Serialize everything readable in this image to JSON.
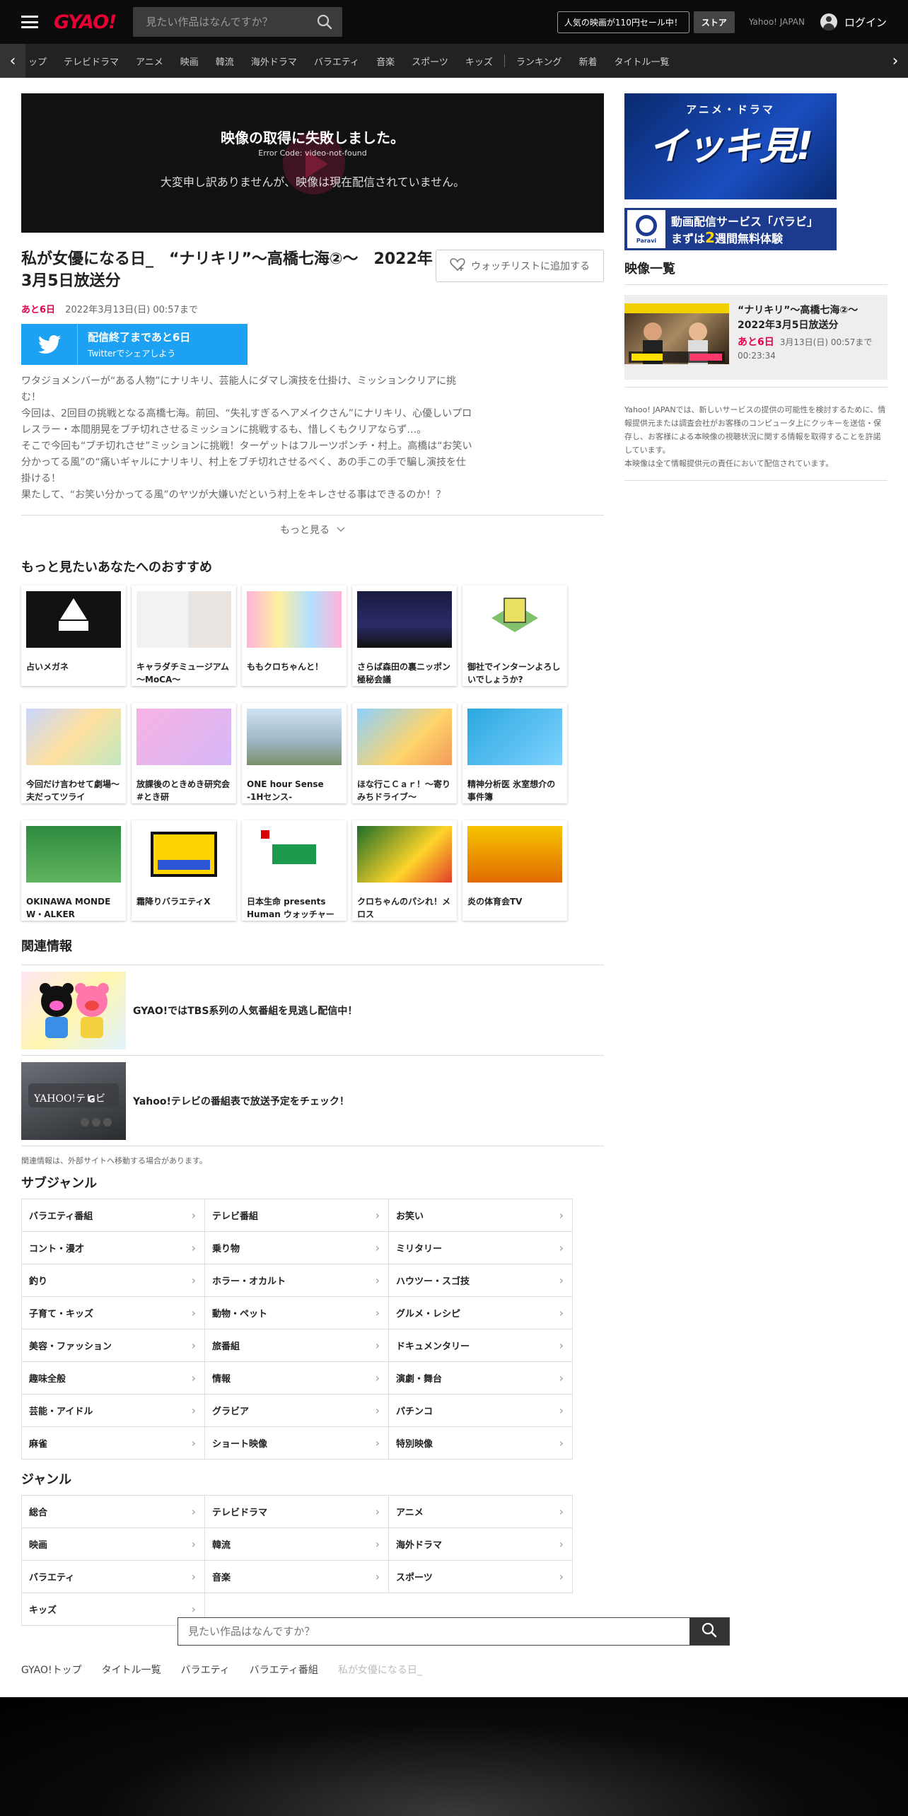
{
  "header": {
    "logo": "GYAO!",
    "search_placeholder": "見たい作品はなんですか？",
    "promo": "人気の映画が110円セール中！",
    "store": "ストア",
    "yahoo": "Yahoo! JAPAN",
    "login": "ログイン"
  },
  "nav": {
    "items": [
      "ップ",
      "テレビドラマ",
      "アニメ",
      "映画",
      "韓流",
      "海外ドラマ",
      "バラエティ",
      "音楽",
      "スポーツ",
      "キッズ"
    ],
    "extra": [
      "ランキング",
      "新着",
      "タイトル一覧"
    ]
  },
  "player": {
    "error_title": "映像の取得に失敗しました。",
    "error_code": "Error Code: video-not-found",
    "error_message": "大変申し訳ありませんが、映像は現在配信されていません。"
  },
  "episode": {
    "title": "私が女優になる日_　“ナリキリ”～高橋七海②～　2022年3月5日放送分",
    "watchlist_label": "ウォッチリストに追加する",
    "remain_badge": "あと6日",
    "remain_date": "2022年3月13日(日) 00:57まで",
    "twitter_line1": "配信終了まであと6日",
    "twitter_line2": "Twitterでシェアしよう",
    "description": [
      "ワタジョメンバーが“ある人物”にナリキリ、芸能人にダマし演技を仕掛け、ミッションクリアに挑む！",
      "今回は、2回目の挑戦となる高橋七海。前回、“失礼すぎるヘアメイクさん”にナリキリ、心優しいプロレスラー・本間朋晃をブチ切れさせるミッションに挑戦するも、惜しくもクリアならず…。",
      "そこで今回も“ブチ切れさせ”ミッションに挑戦！ターゲットはフルーツポンチ・村上。高橋は“お笑い分かってる風”の“痛いギャルにナリキリ、村上をブチ切れさせるべく、あの手この手で騙し演技を仕掛ける！",
      "果たして、“お笑い分かってる風”のヤツが大嫌いだという村上をキレさせる事はできるのか！？"
    ],
    "more_label": "もっと見る"
  },
  "recommend": {
    "title": "もっと見たいあなたへのおすすめ",
    "items": [
      {
        "title": "占いメガネ"
      },
      {
        "title": "キャラダチミュージアム～MoCA～"
      },
      {
        "title": "ももクロちゃんと！"
      },
      {
        "title": "さらば森田の裏ニッポン極秘会議"
      },
      {
        "title": "御社でインターンよろしいでしょうか?"
      },
      {
        "title": "今回だけ言わせて劇場～夫だってツライ"
      },
      {
        "title": "放課後のときめき研究会　#とき研"
      },
      {
        "title": "ONE hour Sense -1Hセンス-"
      },
      {
        "title": "ほな行こＣａｒ！～寄りみちドライブ～"
      },
      {
        "title": "精神分析医 氷室想介の事件簿"
      },
      {
        "title": "OKINAWA MONDE W・ALKER"
      },
      {
        "title": "霜降りバラエティX"
      },
      {
        "title": "日本生命 presents Human ウォッチャー"
      },
      {
        "title": "クロちゃんのパシれ！メロス"
      },
      {
        "title": "炎の体育会TV"
      }
    ]
  },
  "related": {
    "title": "関連情報",
    "items": [
      {
        "text": "GYAO!ではTBS系列の人気番組を見逃し配信中！"
      },
      {
        "text": "Yahoo!テレビの番組表で放送予定をチェック！"
      }
    ],
    "note": "関連情報は、外部サイトへ移動する場合があります。"
  },
  "subgenre": {
    "title": "サブジャンル",
    "items": [
      "バラエティ番組",
      "テレビ番組",
      "お笑い",
      "コント・漫才",
      "乗り物",
      "ミリタリー",
      "釣り",
      "ホラー・オカルト",
      "ハウツー・スゴ技",
      "子育て・キッズ",
      "動物・ペット",
      "グルメ・レシピ",
      "美容・ファッション",
      "旅番組",
      "ドキュメンタリー",
      "趣味全般",
      "情報",
      "演劇・舞台",
      "芸能・アイドル",
      "グラビア",
      "パチンコ",
      "麻雀",
      "ショート映像",
      "特別映像"
    ]
  },
  "genre": {
    "title": "ジャンル",
    "items": [
      "総合",
      "テレビドラマ",
      "アニメ",
      "映画",
      "韓流",
      "海外ドラマ",
      "バラエティ",
      "音楽",
      "スポーツ",
      "キッズ"
    ]
  },
  "bottom_search": {
    "placeholder": "見たい作品はなんですか？"
  },
  "breadcrumbs": [
    "GYAO!トップ",
    "タイトル一覧",
    "バラエティ",
    "バラエティ番組",
    "私が女優になる日_"
  ],
  "sidebar": {
    "ad1_small": "アニメ・ドラマ",
    "ad1_big": "イッキ見!",
    "ad2_logo": "Paravi",
    "ad2_line1": "動画配信サービス「パラビ」",
    "ad2_line2_pre": "まずは",
    "ad2_line2_hl": "2",
    "ad2_line2_post": "週間無料体験",
    "video_list_title": "映像一覧",
    "video": {
      "title": "“ナリキリ”～高橋七海②～　2022年3月5日放送分",
      "badge": "あと6日",
      "date": "3月13日(日) 00:57まで",
      "duration": "00:23:34"
    },
    "notice": [
      "Yahoo! JAPANでは、新しいサービスの提供の可能性を検討するために、情報提供元または調査会社がお客様のコンピュータ上にクッキーを送信・保存し、お客様による本映像の視聴状況に関する情報を取得することを許諾しています。",
      "本映像は全て情報提供元の責任において配信されています。"
    ]
  },
  "colors": {
    "accent": "#e60033",
    "badge": "#e6004b",
    "twitter": "#1da1f2",
    "header_bg": "#0b0b0b"
  }
}
